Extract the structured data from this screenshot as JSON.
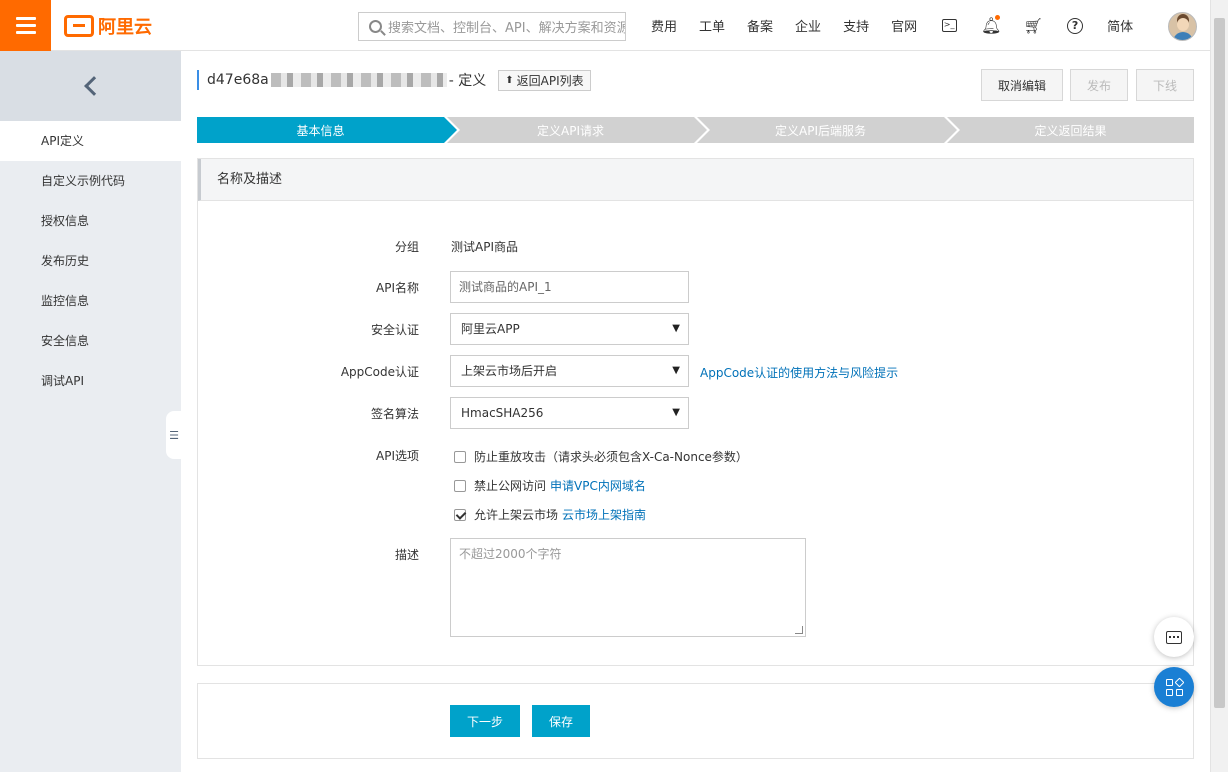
{
  "topbar": {
    "logo_text": "阿里云",
    "search_placeholder": "搜索文档、控制台、API、解决方案和资源",
    "nav": [
      "费用",
      "工单",
      "备案",
      "企业",
      "支持",
      "官网"
    ],
    "lang": "简体",
    "colors": {
      "brand": "#ff6a00"
    }
  },
  "sidebar": {
    "items": [
      "API定义",
      "自定义示例代码",
      "授权信息",
      "发布历史",
      "监控信息",
      "安全信息",
      "调试API"
    ],
    "active_index": 0
  },
  "header": {
    "api_id_prefix": "d47e68a",
    "title_suffix": "- 定义",
    "back_to_list": "返回API列表",
    "cancel_edit": "取消编辑",
    "publish": "发布",
    "offline": "下线"
  },
  "steps": [
    "基本信息",
    "定义API请求",
    "定义API后端服务",
    "定义返回结果"
  ],
  "form": {
    "section_title": "名称及描述",
    "group_label": "分组",
    "group_value": "测试API商品",
    "name_label": "API名称",
    "name_value": "测试商品的API_1",
    "auth_label": "安全认证",
    "auth_value": "阿里云APP",
    "appcode_label": "AppCode认证",
    "appcode_value": "上架云市场后开启",
    "appcode_link": "AppCode认证的使用方法与风险提示",
    "sign_label": "签名算法",
    "sign_value": "HmacSHA256",
    "options_label": "API选项",
    "options": [
      {
        "label": "防止重放攻击（请求头必须包含X-Ca-Nonce参数）",
        "checked": false,
        "link": ""
      },
      {
        "label": "禁止公网访问",
        "checked": false,
        "link": "申请VPC内网域名"
      },
      {
        "label": "允许上架云市场",
        "checked": true,
        "link": "云市场上架指南"
      }
    ],
    "desc_label": "描述",
    "desc_placeholder": "不超过2000个字符"
  },
  "actions": {
    "next": "下一步",
    "save": "保存"
  },
  "colors": {
    "primary": "#00a2ca",
    "link": "#0071b8",
    "step_inactive": "#d1d1d1"
  }
}
